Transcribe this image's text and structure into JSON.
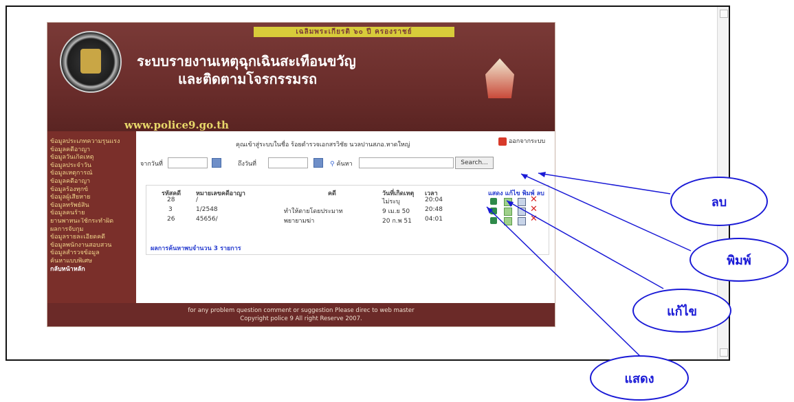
{
  "banner": {
    "top_strip": "เฉลิมพระเกียรติ ๖๐ ปี ครองราชย์",
    "title_line1": "ระบบรายงานเหตุฉุกเฉินสะเทือนขวัญ",
    "title_line2": "และติดตามโจรกรรมรถ",
    "url": "www.police9.go.th"
  },
  "sidebar": {
    "items": [
      "ข้อมูลประเภทความรุนแรง",
      "ข้อมูลคดีอาญา",
      "ข้อมูลวันเกิดเหตุ",
      "ข้อมูลประจำวัน",
      "ข้อมูลเหตุการณ์",
      "ข้อมูลคดีอาญา",
      "ข้อมูลร้องทุกข์",
      "ข้อมูลผู้เสียหาย",
      "ข้อมูลทรัพย์สิน",
      "ข้อมูลคนร้าย",
      "ยานพาหนะใช้กระทำผิด",
      "ผลการจับกุม",
      "ข้อมูลรายละเอียดคดี",
      "ข้อมูลพนักงานสอบสวน",
      "ข้อมูลสำรวจข้อมูล",
      "ค้นหาแบบพิเศษ",
      "กลับหน้าหลัก"
    ]
  },
  "header": {
    "welcome_text": "คุณเข้าสู่ระบบในชื่อ ร้อยตำรวจเอกสรวิชัย นวลปานสภอ.หาดใหญ่",
    "logout_label": "ออกจากระบบ"
  },
  "search": {
    "from_label": "จากวันที่",
    "to_label": "ถึงวันที่",
    "find_label": "ค้นหา",
    "button_label": "Search..."
  },
  "table": {
    "headers": [
      "รหัสคดี",
      "หมายเลขคดีอาญา",
      "คดี",
      "วันที่เกิดเหตุ",
      "เวลา"
    ],
    "actions_header": "แสดง แก้ไข พิมพ์ ลบ",
    "rows": [
      {
        "id": "28",
        "case_no": "/",
        "case": "",
        "date": "ไม่ระบุ",
        "time": "20:04"
      },
      {
        "id": "3",
        "case_no": "1/2548",
        "case": "ทำให้ตายโดยประมาท",
        "date": "9 เม.ย 50",
        "time": "20:48"
      },
      {
        "id": "26",
        "case_no": "45656/",
        "case": "พยายามฆ่า",
        "date": "20 ก.พ 51",
        "time": "04:01"
      }
    ],
    "result_summary": "ผลการค้นหาพบจำนวน 3 รายการ"
  },
  "footer": {
    "line1": "for any problem question comment or suggestion Please direc to web master",
    "line2": "Copyright police 9 All right Reserve 2007."
  },
  "callouts": {
    "delete": "ลบ",
    "print": "พิมพ์",
    "edit": "แก้ไข",
    "show": "แสดง"
  },
  "colors": {
    "callout_blue": "#1a1ad6",
    "banner_maroon": "#6a2d2b",
    "strip_yellow": "#d8cc3a"
  }
}
